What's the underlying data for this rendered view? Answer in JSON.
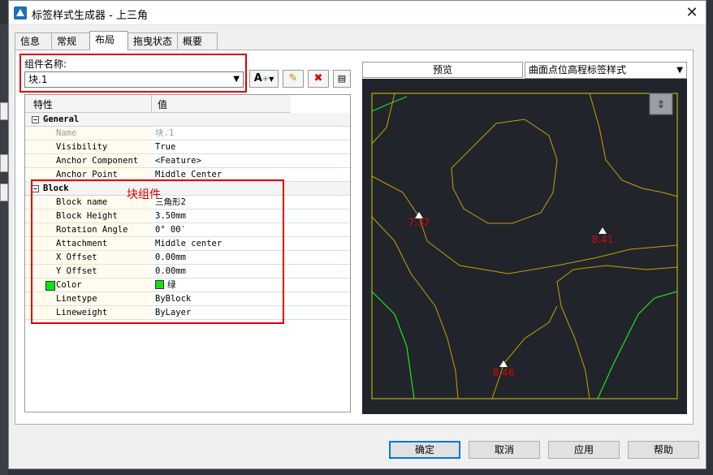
{
  "window": {
    "title": "标签样式生成器 - 上三角"
  },
  "tabs": [
    "信息",
    "常规",
    "布局",
    "拖曳状态",
    "概要"
  ],
  "component": {
    "label": "组件名称:",
    "value": "块.1"
  },
  "grid": {
    "headers": [
      "特性",
      "值"
    ],
    "general": {
      "title": "General",
      "rows": [
        {
          "k": "Name",
          "v": "块.1"
        },
        {
          "k": "Visibility",
          "v": "True"
        },
        {
          "k": "Anchor Component",
          "v": "<Feature>"
        },
        {
          "k": "Anchor Point",
          "v": "Middle Center"
        }
      ]
    },
    "block": {
      "title": "Block",
      "rows": [
        {
          "k": "Block name",
          "v": "三角形2"
        },
        {
          "k": "Block Height",
          "v": "3.50mm"
        },
        {
          "k": "Rotation Angle",
          "v": "0° 00′"
        },
        {
          "k": "Attachment",
          "v": "Middle center"
        },
        {
          "k": "X Offset",
          "v": "0.00mm"
        },
        {
          "k": "Y Offset",
          "v": "0.00mm"
        },
        {
          "k": "Color",
          "v": "绿"
        },
        {
          "k": "Linetype",
          "v": "ByBlock"
        },
        {
          "k": "Lineweight",
          "v": "ByLayer"
        }
      ]
    }
  },
  "annotation": "块组件",
  "preview": {
    "tab_label": "预览",
    "style_select": "曲面点位高程标签样式",
    "labels": [
      "7.37",
      "8.41",
      "8.46"
    ]
  },
  "buttons": {
    "ok": "确定",
    "cancel": "取消",
    "apply": "应用",
    "help": "帮助"
  },
  "colors": {
    "accent": "#0078d7",
    "highlight": "#e00000",
    "block_color": "#14e014",
    "preview_bg": "#21252b",
    "contour": "#c8a000"
  }
}
